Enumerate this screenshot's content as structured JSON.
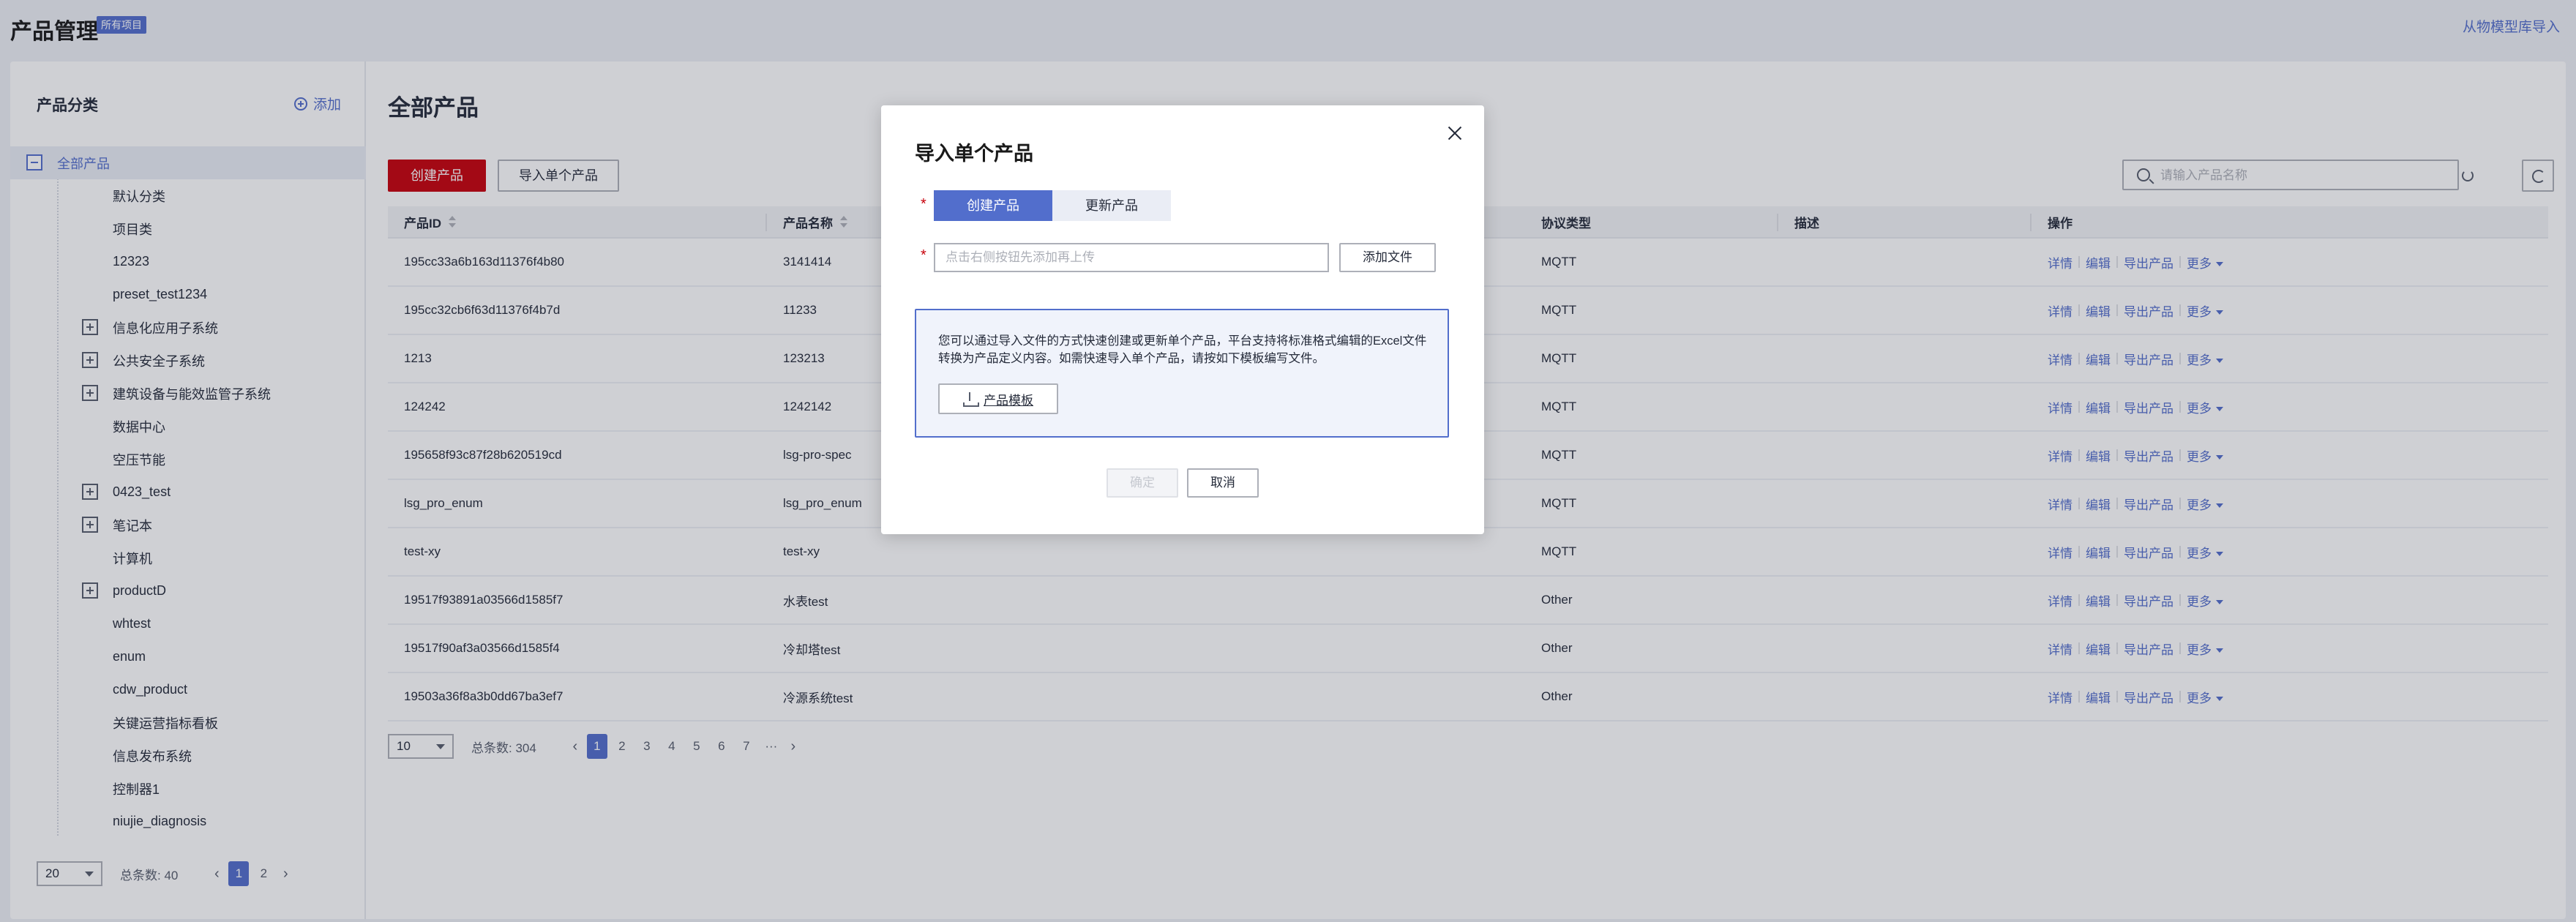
{
  "header": {
    "title": "产品管理",
    "tag": "所有项目",
    "import_link": "从物模型库导入"
  },
  "sidebar": {
    "title": "产品分类",
    "add_label": "添加",
    "root": "全部产品",
    "items": [
      {
        "label": "默认分类",
        "expandable": false
      },
      {
        "label": "项目类",
        "expandable": false
      },
      {
        "label": "12323",
        "expandable": false
      },
      {
        "label": "preset_test1234",
        "expandable": false
      },
      {
        "label": "信息化应用子系统",
        "expandable": true
      },
      {
        "label": "公共安全子系统",
        "expandable": true
      },
      {
        "label": "建筑设备与能效监管子系统",
        "expandable": true
      },
      {
        "label": "数据中心",
        "expandable": false
      },
      {
        "label": "空压节能",
        "expandable": false
      },
      {
        "label": "0423_test",
        "expandable": true
      },
      {
        "label": "笔记本",
        "expandable": true
      },
      {
        "label": "计算机",
        "expandable": false
      },
      {
        "label": "productD",
        "expandable": true
      },
      {
        "label": "whtest",
        "expandable": false
      },
      {
        "label": "enum",
        "expandable": false
      },
      {
        "label": "cdw_product",
        "expandable": false
      },
      {
        "label": "关键运营指标看板",
        "expandable": false
      },
      {
        "label": "信息发布系统",
        "expandable": false
      },
      {
        "label": "控制器1",
        "expandable": false
      },
      {
        "label": "niujie_diagnosis",
        "expandable": false
      }
    ],
    "pager": {
      "page_size": "20",
      "total": "总条数:  40",
      "pages": [
        "1",
        "2"
      ],
      "current": "1"
    }
  },
  "main": {
    "title": "全部产品",
    "create_button": "创建产品",
    "import_button": "导入单个产品",
    "search_placeholder": "请输入产品名称",
    "columns": [
      "产品ID",
      "产品名称",
      "",
      "协议类型",
      "描述",
      "操作"
    ],
    "rows": [
      {
        "id": "195cc33a6b163d11376f4b80",
        "name": "3141414",
        "protocol": "MQTT",
        "desc": ""
      },
      {
        "id": "195cc32cb6f63d11376f4b7d",
        "name": "11233",
        "protocol": "MQTT",
        "desc": ""
      },
      {
        "id": "1213",
        "name": "123213",
        "protocol": "MQTT",
        "desc": ""
      },
      {
        "id": "124242",
        "name": "1242142",
        "protocol": "MQTT",
        "desc": ""
      },
      {
        "id": "195658f93c87f28b620519cd",
        "name": "lsg-pro-spec",
        "protocol": "MQTT",
        "desc": ""
      },
      {
        "id": "lsg_pro_enum",
        "name": "lsg_pro_enum",
        "protocol": "MQTT",
        "desc": ""
      },
      {
        "id": "test-xy",
        "name": "test-xy",
        "protocol": "MQTT",
        "desc": ""
      },
      {
        "id": "19517f93891a03566d1585f7",
        "name": "水表test",
        "protocol": "Other",
        "desc": ""
      },
      {
        "id": "19517f90af3a03566d1585f4",
        "name": "冷却塔test",
        "protocol": "Other",
        "desc": ""
      },
      {
        "id": "19503a36f8a3b0dd67ba3ef7",
        "name": "冷源系统test",
        "protocol": "Other",
        "desc": ""
      }
    ],
    "ops": {
      "detail": "详情",
      "edit": "编辑",
      "export": "导出产品",
      "more": "更多"
    },
    "pager": {
      "page_size": "10",
      "total": "总条数:  304",
      "pages": [
        "1",
        "2",
        "3",
        "4",
        "5",
        "6",
        "7"
      ],
      "ellipsis": "···",
      "current": "1"
    }
  },
  "modal": {
    "title": "导入单个产品",
    "segment": [
      "创建产品",
      "更新产品"
    ],
    "selected": "创建产品",
    "required_mark": "*",
    "file_placeholder": "点击右侧按钮先添加再上传",
    "add_file_button": "添加文件",
    "info_text": "您可以通过导入文件的方式快速创建或更新单个产品，平台支持将标准格式编辑的Excel文件转换为产品定义内容。如需快速导入单个产品，请按如下模板编写文件。",
    "template_button": "产品模板",
    "confirm_button": "确定",
    "cancel_button": "取消"
  },
  "colors": {
    "accent": "#526ecc",
    "brand_red": "#c7000b",
    "text": "#252b3a"
  }
}
